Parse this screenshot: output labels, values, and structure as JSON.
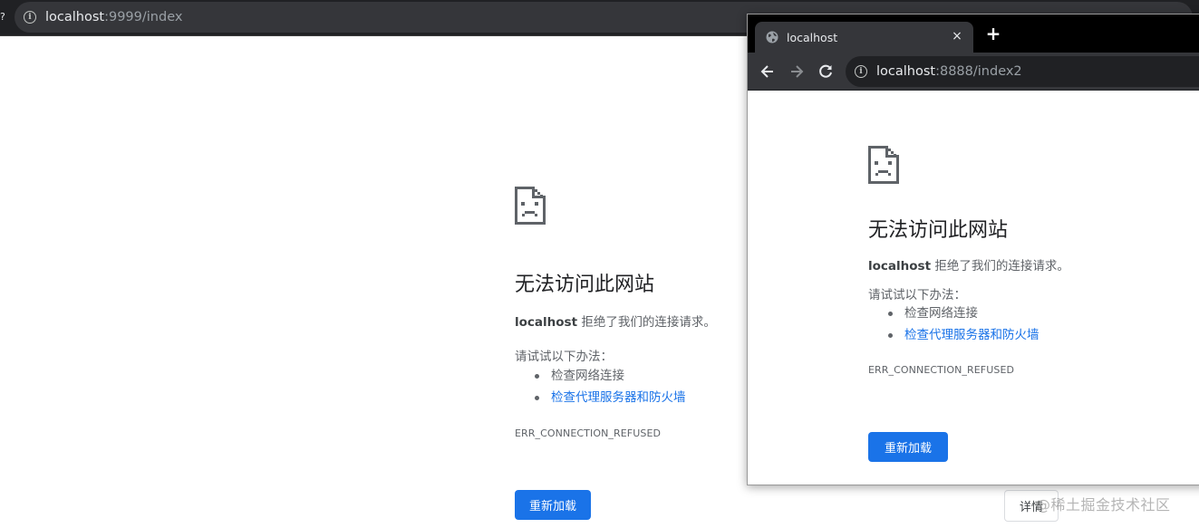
{
  "back_window": {
    "left_edge_char": "?",
    "url_host": "localhost",
    "url_path": ":9999/index",
    "error": {
      "title": "无法访问此网站",
      "host": "localhost",
      "refused_text": " 拒绝了我们的连接请求。",
      "try_text": "请试试以下办法：",
      "suggestions": [
        "检查网络连接",
        "检查代理服务器和防火墙"
      ],
      "code": "ERR_CONNECTION_REFUSED",
      "reload_label": "重新加载",
      "details_label": "详情"
    }
  },
  "front_window": {
    "tab_title": "localhost",
    "tab_close": "×",
    "new_tab": "+",
    "url_host": "localhost",
    "url_path": ":8888/index2",
    "error": {
      "title": "无法访问此网站",
      "host": "localhost",
      "refused_text": " 拒绝了我们的连接请求。",
      "try_text": "请试试以下办法：",
      "suggestions": [
        "检查网络连接",
        "检查代理服务器和防火墙"
      ],
      "code": "ERR_CONNECTION_REFUSED",
      "reload_label": "重新加载"
    }
  },
  "watermark": "@稀土掘金技术社区",
  "colors": {
    "link": "#1a73e8",
    "button": "#1a73e8",
    "toolbar_dark": "#35363a",
    "frame_dark": "#202124"
  },
  "icons": [
    "info-icon",
    "sad-page-icon",
    "globe-icon",
    "close-icon",
    "plus-icon",
    "back-arrow-icon",
    "forward-arrow-icon",
    "reload-icon"
  ]
}
